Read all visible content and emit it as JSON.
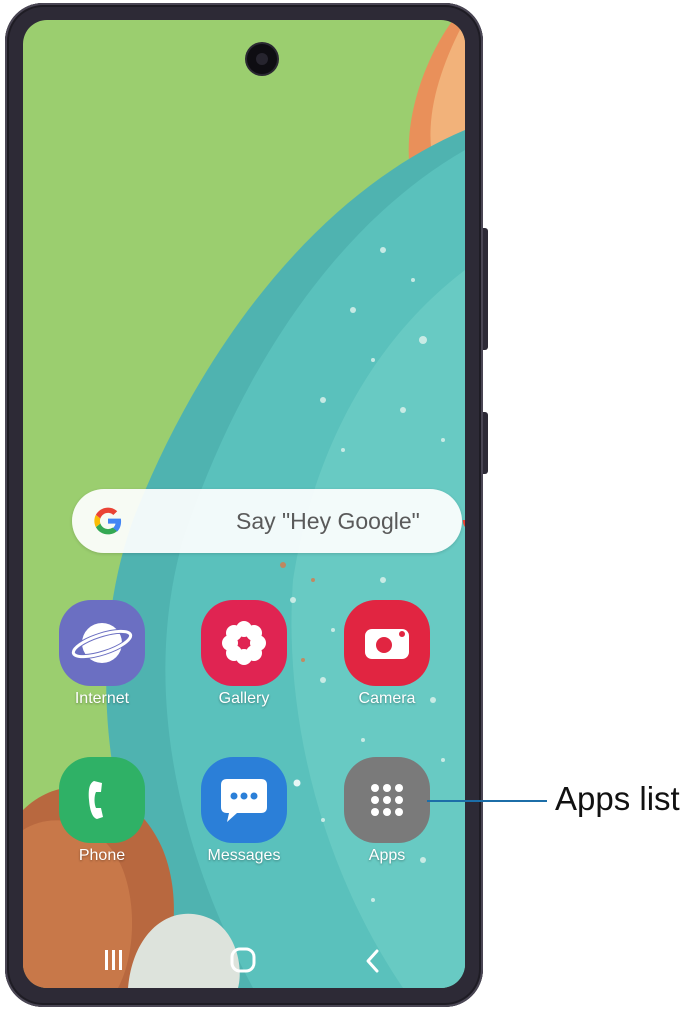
{
  "search": {
    "text": "Say \"Hey Google\""
  },
  "apps": {
    "internet": "Internet",
    "gallery": "Gallery",
    "camera": "Camera",
    "phone": "Phone",
    "messages": "Messages",
    "apps": "Apps"
  },
  "callout": {
    "label": "Apps list"
  },
  "colors": {
    "wallpaper_green": "#9bce6f",
    "internet": "#6b6fc2",
    "gallery": "#e02452",
    "camera": "#e12541",
    "phone": "#2fb166",
    "messages": "#2b7fd8",
    "apps": "#7a7a7a",
    "callout_line": "#1c6ea8"
  },
  "icons": {
    "search_logo": "google-g-icon",
    "mic": "microphone-icon",
    "nav_recents": "recents-icon",
    "nav_home": "home-icon",
    "nav_back": "back-icon"
  }
}
